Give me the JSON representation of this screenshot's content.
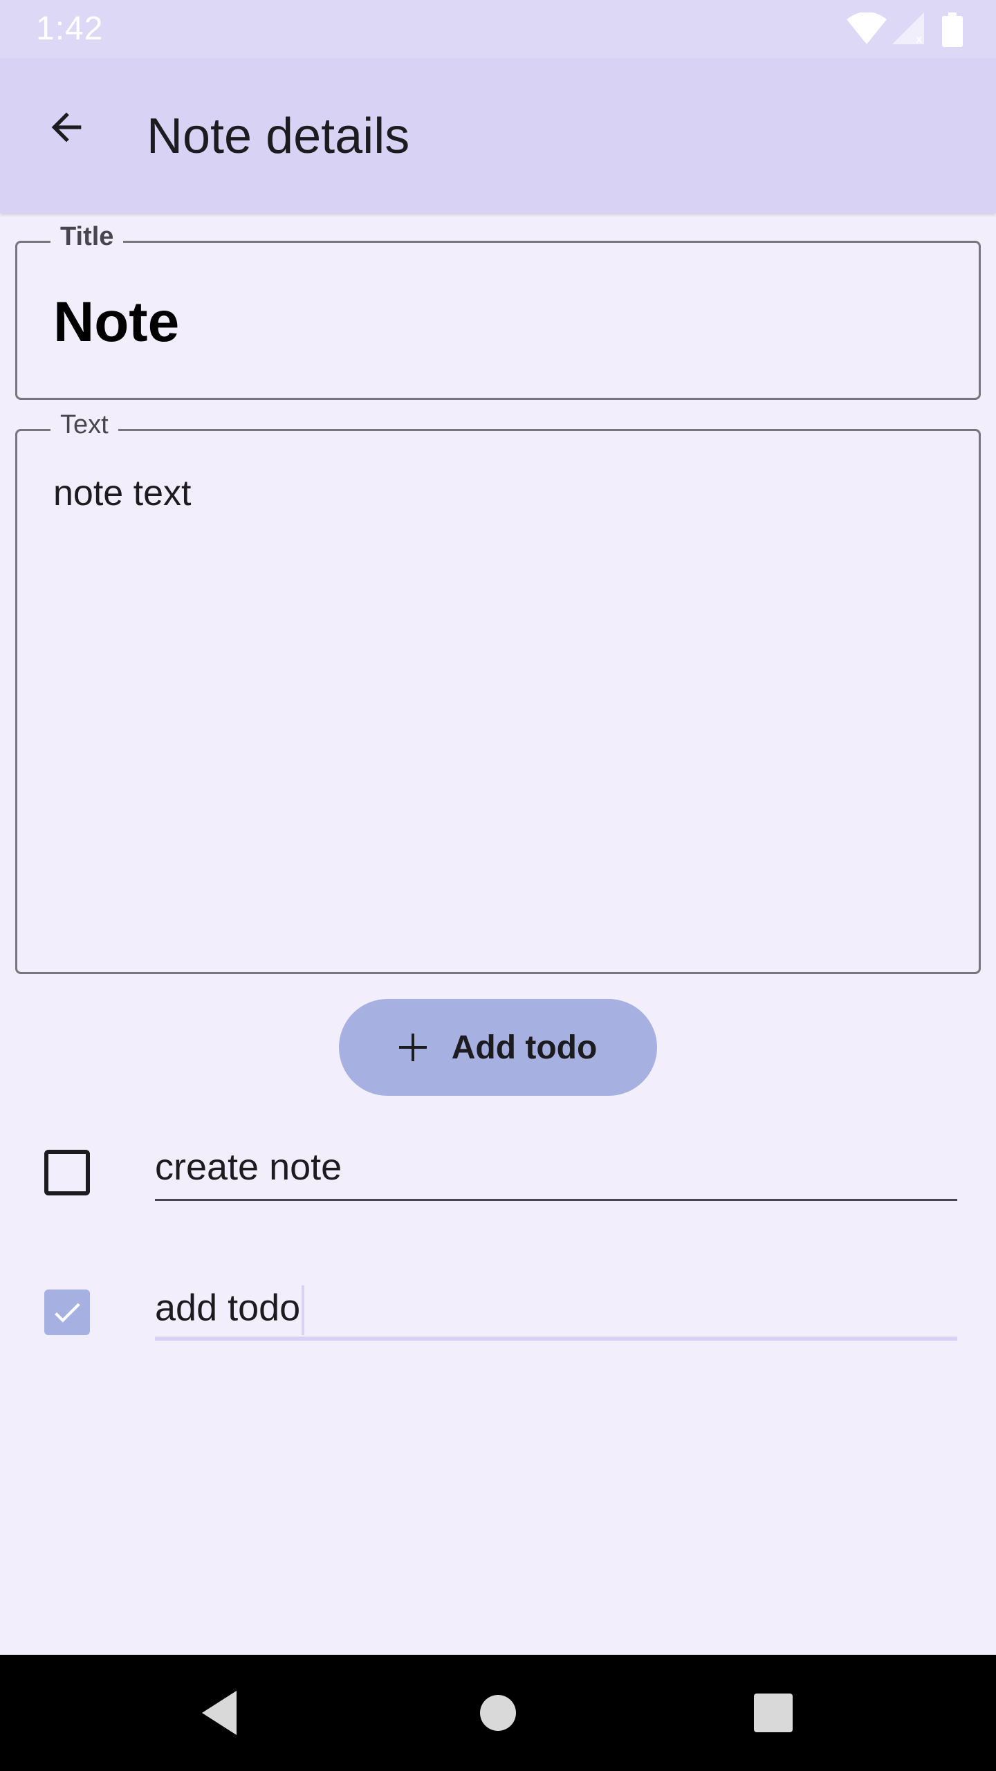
{
  "status_bar": {
    "time": "1:42"
  },
  "app_bar": {
    "title": "Note details",
    "back_icon": "arrow-back-icon"
  },
  "title_field": {
    "label": "Title",
    "value": "Note"
  },
  "text_field": {
    "label": "Text",
    "value": "note text"
  },
  "add_todo_button": {
    "label": "Add todo",
    "icon": "plus-icon"
  },
  "todos": [
    {
      "text": "create note",
      "checked": false
    },
    {
      "text": "add todo",
      "checked": true,
      "focused": true
    }
  ],
  "colors": {
    "background": "#f3eefc",
    "app_bar": "#d8d3f5",
    "accent": "#a6b0e1",
    "outline": "#79747e"
  }
}
